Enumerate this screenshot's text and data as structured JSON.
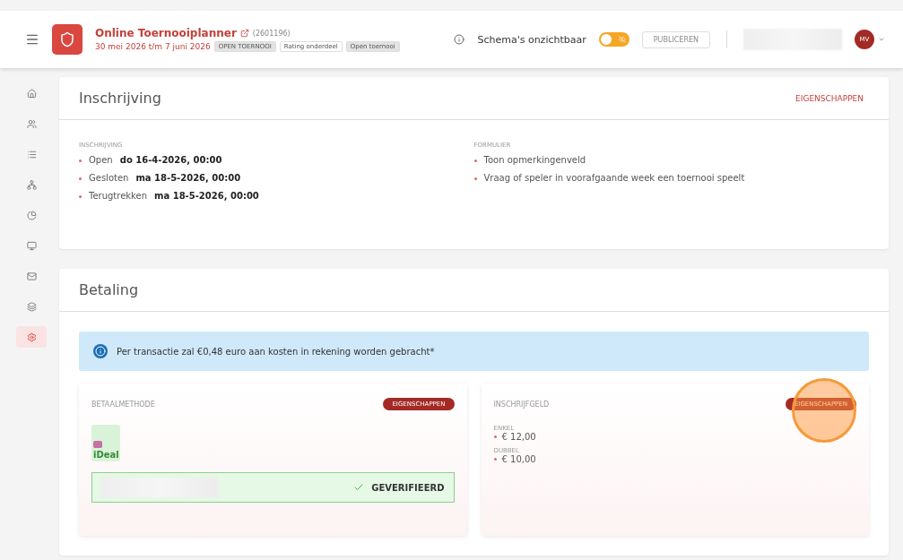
{
  "header": {
    "title": "Online Toernooiplanner",
    "id": "(2601196)",
    "dates": "30 mei 2026 t/m 7 juni 2026",
    "tags": [
      {
        "label": "OPEN TOERNOOI",
        "kind": "grey"
      },
      {
        "label": "Rating onderdeel",
        "kind": "white"
      },
      {
        "label": "Open toernooi",
        "kind": "grey"
      }
    ],
    "visibility_label": "Schema's onzichtbaar",
    "visibility_toggle": {
      "on": false
    },
    "publish_button": {
      "label": "PUBLICEREN",
      "disabled": true
    },
    "avatar": "MV"
  },
  "sidebar": {
    "items": [
      {
        "selected": false
      },
      {
        "selected": false
      },
      {
        "selected": false
      },
      {
        "selected": false
      },
      {
        "selected": false
      },
      {
        "selected": false
      },
      {
        "selected": false
      },
      {
        "selected": false
      },
      {
        "selected": true
      }
    ]
  },
  "inschrijving": {
    "title": "Inschrijving",
    "action": "EIGENSCHAPPEN",
    "groups": [
      {
        "heading": "INSCHRIJVING",
        "items": [
          {
            "label": "Open",
            "value": "do 16-4-2026, 00:00"
          },
          {
            "label": "Gesloten",
            "value": "ma 18-5-2026, 00:00"
          },
          {
            "label": "Terugtrekken",
            "value": "ma 18-5-2026, 00:00"
          }
        ]
      },
      {
        "heading": "FORMULIER",
        "items": [
          {
            "label": "Toon opmerkingenveld"
          },
          {
            "label": "Vraag of speler in voorafgaande week een toernooi speelt"
          }
        ]
      }
    ]
  },
  "betaling": {
    "title": "Betaling",
    "notice": "Per transactie zal €0,48 euro aan kosten in rekening worden gebracht*",
    "method": {
      "heading": "BETAALMETHODE",
      "action": "EIGENSCHAPPEN",
      "name": "iDeal",
      "status": "GEVERIFIEERD"
    },
    "fee": {
      "heading": "INSCHRIJFGELD",
      "action": "EIGENSCHAPPEN",
      "highlighted": true,
      "groups": [
        {
          "label": "ENKEL",
          "value": "€ 12,00"
        },
        {
          "label": "DUBBEL",
          "value": "€ 10,00"
        }
      ]
    }
  }
}
